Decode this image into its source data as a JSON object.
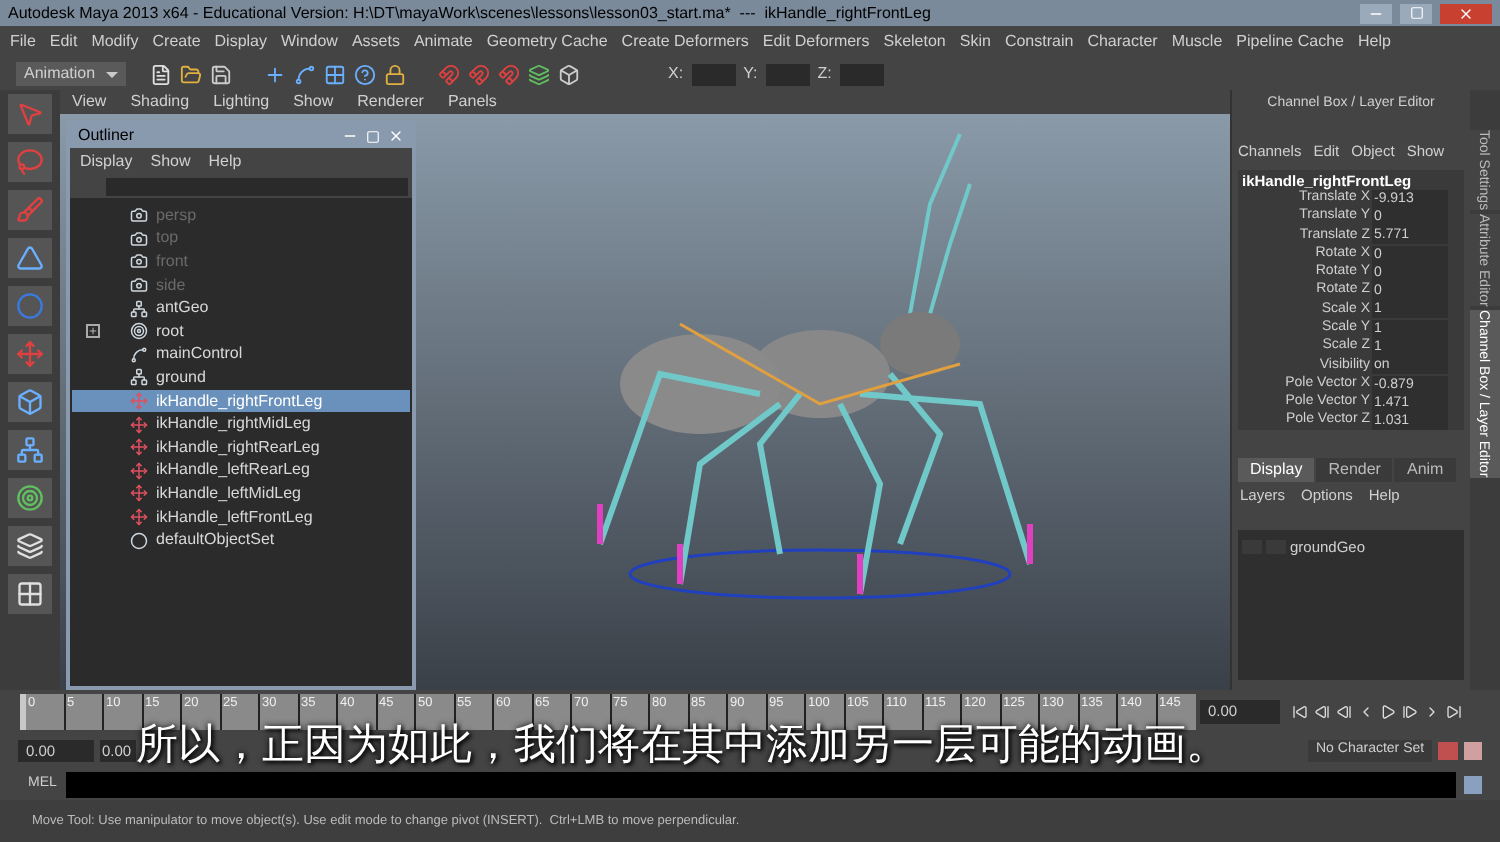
{
  "window": {
    "title": "Autodesk Maya 2013 x64 - Educational Version: H:\\DT\\mayaWork\\scenes\\lessons\\lesson03_start.ma*  ---  ikHandle_rightFrontLeg"
  },
  "menu_bar": [
    "File",
    "Edit",
    "Modify",
    "Create",
    "Display",
    "Window",
    "Assets",
    "Animate",
    "Geometry Cache",
    "Create Deformers",
    "Edit Deformers",
    "Skeleton",
    "Skin",
    "Constrain",
    "Character",
    "Muscle",
    "Pipeline Cache",
    "Help"
  ],
  "toolbar": {
    "menu_set": "Animation",
    "coord_labels": [
      "X:",
      "Y:",
      "Z:"
    ]
  },
  "viewport": {
    "menu": [
      "View",
      "Shading",
      "Lighting",
      "Show",
      "Renderer",
      "Panels"
    ]
  },
  "outliner": {
    "title": "Outliner",
    "menu": [
      "Display",
      "Show",
      "Help"
    ],
    "items": [
      {
        "label": "persp",
        "kind": "camera",
        "dimmed": true,
        "selected": false,
        "expandable": false
      },
      {
        "label": "top",
        "kind": "camera",
        "dimmed": true,
        "selected": false,
        "expandable": false
      },
      {
        "label": "front",
        "kind": "camera",
        "dimmed": true,
        "selected": false,
        "expandable": false
      },
      {
        "label": "side",
        "kind": "camera",
        "dimmed": true,
        "selected": false,
        "expandable": false
      },
      {
        "label": "antGeo",
        "kind": "group",
        "dimmed": false,
        "selected": false,
        "expandable": false
      },
      {
        "label": "root",
        "kind": "joint",
        "dimmed": false,
        "selected": false,
        "expandable": true
      },
      {
        "label": "mainControl",
        "kind": "curve",
        "dimmed": false,
        "selected": false,
        "expandable": false
      },
      {
        "label": "ground",
        "kind": "group",
        "dimmed": false,
        "selected": false,
        "expandable": false
      },
      {
        "label": "ikHandle_rightFrontLeg",
        "kind": "ik",
        "dimmed": false,
        "selected": true,
        "expandable": false
      },
      {
        "label": "ikHandle_rightMidLeg",
        "kind": "ik",
        "dimmed": false,
        "selected": false,
        "expandable": false
      },
      {
        "label": "ikHandle_rightRearLeg",
        "kind": "ik",
        "dimmed": false,
        "selected": false,
        "expandable": false
      },
      {
        "label": "ikHandle_leftRearLeg",
        "kind": "ik",
        "dimmed": false,
        "selected": false,
        "expandable": false
      },
      {
        "label": "ikHandle_leftMidLeg",
        "kind": "ik",
        "dimmed": false,
        "selected": false,
        "expandable": false
      },
      {
        "label": "ikHandle_leftFrontLeg",
        "kind": "ik",
        "dimmed": false,
        "selected": false,
        "expandable": false
      },
      {
        "label": "defaultObjectSet",
        "kind": "set",
        "dimmed": false,
        "selected": false,
        "expandable": false
      }
    ]
  },
  "channel_box": {
    "title": "Channel Box / Layer Editor",
    "menu": [
      "Channels",
      "Edit",
      "Object",
      "Show"
    ],
    "node": "ikHandle_rightFrontLeg",
    "channels": [
      {
        "name": "Translate X",
        "value": "-9.913"
      },
      {
        "name": "Translate Y",
        "value": "0"
      },
      {
        "name": "Translate Z",
        "value": "5.771"
      },
      {
        "name": "Rotate X",
        "value": "0"
      },
      {
        "name": "Rotate Y",
        "value": "0"
      },
      {
        "name": "Rotate Z",
        "value": "0"
      },
      {
        "name": "Scale X",
        "value": "1"
      },
      {
        "name": "Scale Y",
        "value": "1"
      },
      {
        "name": "Scale Z",
        "value": "1"
      },
      {
        "name": "Visibility",
        "value": "on"
      },
      {
        "name": "Pole Vector X",
        "value": "-0.879"
      },
      {
        "name": "Pole Vector Y",
        "value": "1.471"
      },
      {
        "name": "Pole Vector Z",
        "value": "1.031"
      }
    ],
    "layer_tabs": [
      {
        "label": "Display",
        "selected": true
      },
      {
        "label": "Render",
        "selected": false
      },
      {
        "label": "Anim",
        "selected": false
      }
    ],
    "layer_menu": [
      "Layers",
      "Options",
      "Help"
    ],
    "layers": [
      {
        "name": "groundGeo"
      }
    ]
  },
  "side_tabs": [
    {
      "label": "Tool Settings",
      "selected": false
    },
    {
      "label": "Attribute Editor",
      "selected": false
    },
    {
      "label": "Channel Box / Layer Editor",
      "selected": true
    }
  ],
  "timeline": {
    "ticks": [
      "0",
      "5",
      "10",
      "15",
      "20",
      "25",
      "30",
      "35",
      "40",
      "45",
      "50",
      "55",
      "60",
      "65",
      "70",
      "75",
      "80",
      "85",
      "90",
      "95",
      "100",
      "105",
      "110",
      "115",
      "120",
      "125",
      "130",
      "135",
      "140",
      "145"
    ],
    "current_frame": "0.00",
    "level": 0
  },
  "range": {
    "start": "0.00",
    "end": "0.00",
    "character_set": "No Character Set"
  },
  "command_line": {
    "label": "MEL"
  },
  "status_line": "Move Tool: Use manipulator to move object(s). Use edit mode to change pivot (INSERT).  Ctrl+LMB to move perpendicular.",
  "subtitle": "所以，正因为如此，我们将在其中添加另一层可能的动画。"
}
